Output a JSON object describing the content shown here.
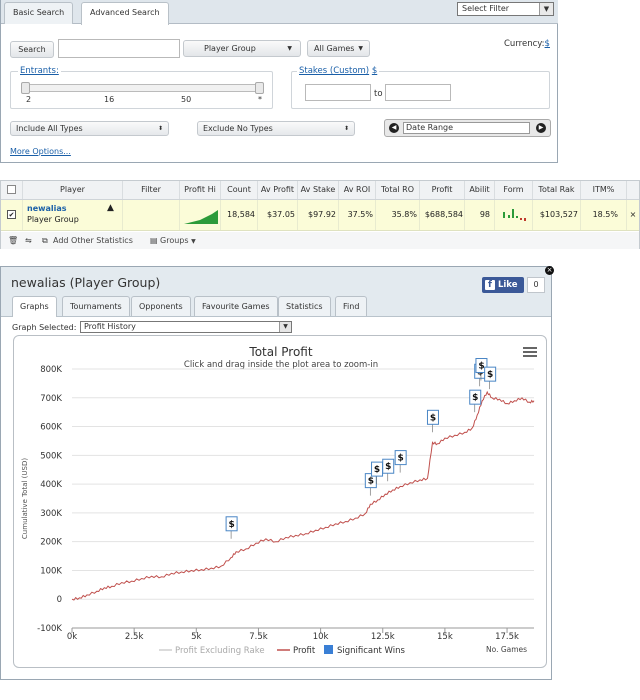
{
  "search_panel": {
    "tabs": [
      "Basic Search",
      "Advanced Search"
    ],
    "select_filter": "Select Filter",
    "search_button": "Search",
    "search_value": "",
    "player_group": "Player Group",
    "all_games": "All Games",
    "currency_label": "Currency:",
    "currency_value": "$",
    "entrants_label": "Entrants:",
    "entrant_ticks": [
      "2",
      "16",
      "50",
      "*"
    ],
    "stakes_label": "Stakes (Custom)",
    "stakes_currency": "$",
    "stakes_from": "",
    "stakes_to_label": "to",
    "stakes_to": "",
    "include_types": "Include All Types",
    "exclude_types": "Exclude No Types",
    "date_range": "Date Range",
    "more_options": "More Options..."
  },
  "stats_table": {
    "headers": [
      "Player",
      "Filter",
      "Profit Hi",
      "Count",
      "Av Profit",
      "Av Stake",
      "Av ROI",
      "Total RO",
      "Profit",
      "Abilit",
      "Form",
      "Total Rak",
      "ITM%"
    ],
    "row": {
      "name": "newalias",
      "group": "Player Group",
      "count": "18,584",
      "av_profit": "$37.05",
      "av_stake": "$97.92",
      "av_roi": "37.5%",
      "total_roi": "35.8%",
      "profit": "$688,584",
      "ability": "98",
      "total_rake": "$103,527",
      "itm": "18.5%"
    },
    "footer": {
      "add_stats": "Add Other Statistics",
      "groups": "Groups"
    }
  },
  "graph_panel": {
    "title": "newalias (Player Group)",
    "like_label": "Like",
    "like_count": "0",
    "tabs": [
      "Graphs",
      "Tournaments",
      "Opponents",
      "Favourite Games",
      "Statistics",
      "Find"
    ],
    "graph_selected_label": "Graph Selected:",
    "graph_selected_value": "Profit History"
  },
  "chart_data": {
    "type": "line",
    "title": "Total Profit",
    "subtitle": "Click and drag inside the plot area to zoom-in",
    "ylabel": "Cumulative Total (USD)",
    "xlabel": "No. Games",
    "xlim": [
      0,
      18584
    ],
    "ylim": [
      -100000,
      800000
    ],
    "x_ticks": [
      "0k",
      "2.5k",
      "5k",
      "7.5k",
      "10k",
      "12.5k",
      "15k",
      "17.5k"
    ],
    "y_ticks": [
      "-100K",
      "0",
      "100K",
      "200K",
      "300K",
      "400K",
      "500K",
      "600K",
      "700K",
      "800K"
    ],
    "legend": [
      "Profit Excluding Rake",
      "Profit",
      "Significant Wins"
    ],
    "colors": {
      "profit": "#c0504d",
      "excl_rake": "#cfcfcf",
      "sig_wins": "#3a7fd5"
    },
    "series": [
      {
        "name": "Profit",
        "x": [
          0,
          300,
          600,
          1000,
          1300,
          1600,
          2000,
          2400,
          2800,
          3200,
          3600,
          4000,
          4400,
          4800,
          5200,
          5600,
          6000,
          6400,
          6600,
          7000,
          7400,
          7800,
          8200,
          8600,
          9000,
          9400,
          9800,
          10200,
          10600,
          11000,
          11400,
          11800,
          12000,
          12300,
          12600,
          12900,
          13200,
          13600,
          14000,
          14300,
          14500,
          14700,
          15000,
          15400,
          15800,
          16100,
          16300,
          16500,
          16700,
          16900,
          17200,
          17500,
          17800,
          18100,
          18400,
          18584
        ],
        "y": [
          0,
          5000,
          15000,
          28000,
          40000,
          45000,
          58000,
          63000,
          72000,
          80000,
          78000,
          90000,
          95000,
          100000,
          103000,
          108000,
          115000,
          145000,
          165000,
          175000,
          195000,
          210000,
          200000,
          215000,
          222000,
          228000,
          240000,
          250000,
          262000,
          270000,
          282000,
          298000,
          330000,
          345000,
          365000,
          380000,
          392000,
          405000,
          415000,
          420000,
          545000,
          540000,
          560000,
          570000,
          580000,
          595000,
          640000,
          690000,
          720000,
          700000,
          695000,
          680000,
          690000,
          700000,
          685000,
          690000
        ]
      }
    ],
    "significant_wins": [
      [
        6400,
        210000
      ],
      [
        12000,
        360000
      ],
      [
        12250,
        400000
      ],
      [
        12700,
        410000
      ],
      [
        13200,
        440000
      ],
      [
        14500,
        580000
      ],
      [
        16200,
        650000
      ],
      [
        16400,
        740000
      ],
      [
        16450,
        760000
      ],
      [
        16800,
        730000
      ]
    ]
  }
}
